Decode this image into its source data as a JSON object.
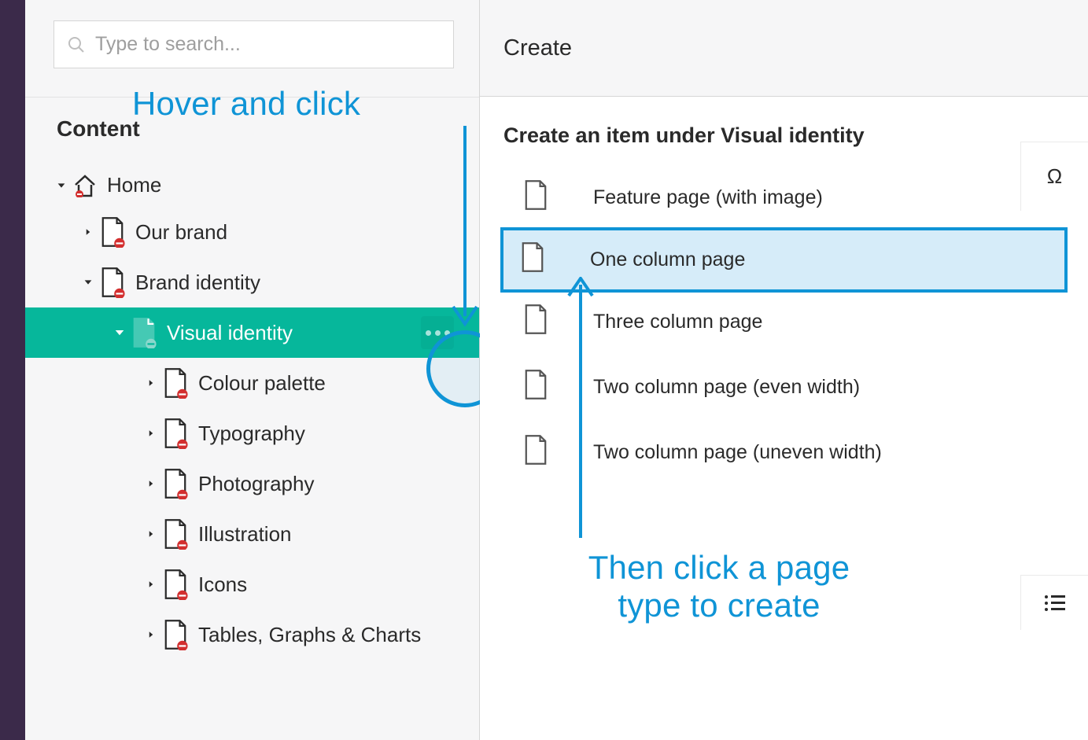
{
  "search": {
    "placeholder": "Type to search..."
  },
  "sidebar": {
    "header": "Content",
    "tree": {
      "home": "Home",
      "items": [
        "Our brand",
        "Brand identity"
      ],
      "visual_identity": "Visual identity",
      "sub": [
        "Colour palette",
        "Typography",
        "Photography",
        "Illustration",
        "Icons",
        "Tables, Graphs & Charts"
      ]
    }
  },
  "right": {
    "header": "Create",
    "create_under": "Create an item under Visual identity",
    "types": [
      "Feature page (with image)",
      "One column page",
      "Three column page",
      "Two column page (even width)",
      "Two column page (uneven width)"
    ]
  },
  "annotations": {
    "top": "Hover and click",
    "bottom_1": "Then click a page",
    "bottom_2": "type to create"
  },
  "far_right": {
    "omega": "Ω"
  }
}
